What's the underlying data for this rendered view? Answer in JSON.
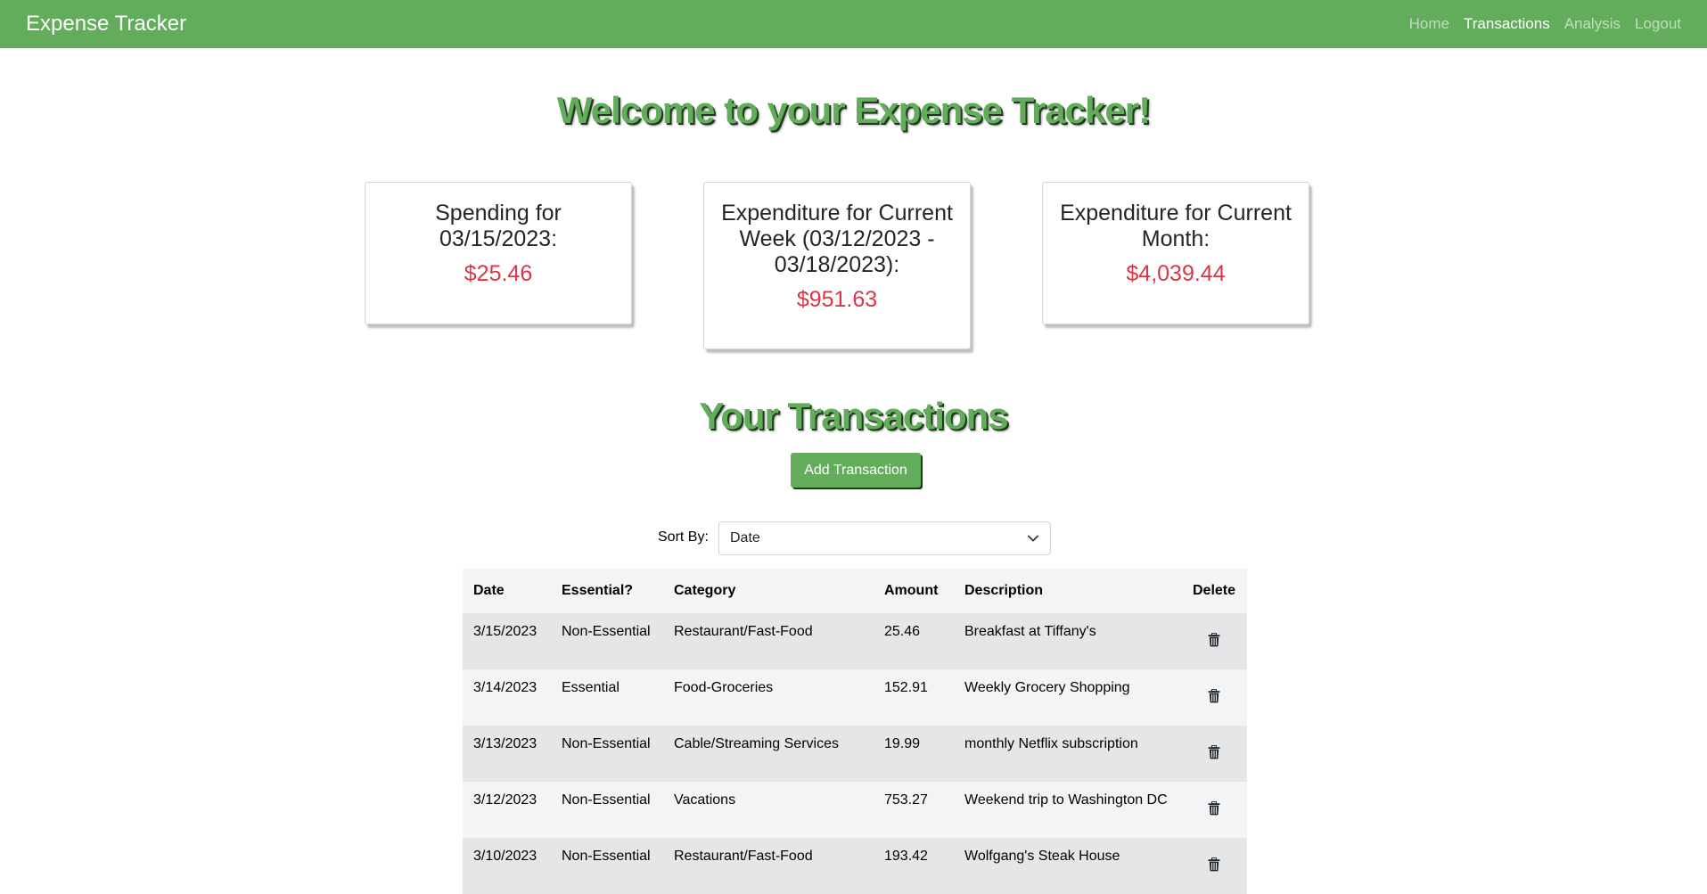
{
  "nav": {
    "brand": "Expense Tracker",
    "links": [
      "Home",
      "Transactions",
      "Analysis",
      "Logout"
    ],
    "active": "Transactions"
  },
  "welcome": "Welcome to your Expense Tracker!",
  "cards": [
    {
      "title": "Spending for 03/15/2023:",
      "value": "$25.46"
    },
    {
      "title": "Expenditure for Current Week (03/12/2023 - 03/18/2023):",
      "value": "$951.63"
    },
    {
      "title": "Expenditure for Current Month:",
      "value": "$4,039.44"
    }
  ],
  "transactions_title": "Your Transactions",
  "add_button": "Add Transaction",
  "sort": {
    "label": "Sort By:",
    "value": "Date"
  },
  "table": {
    "headers": [
      "Date",
      "Essential?",
      "Category",
      "Amount",
      "Description",
      "Delete"
    ],
    "rows": [
      [
        "3/15/2023",
        "Non-Essential",
        "Restaurant/Fast-Food",
        "25.46",
        "Breakfast at Tiffany's"
      ],
      [
        "3/14/2023",
        "Essential",
        "Food-Groceries",
        "152.91",
        "Weekly Grocery Shopping"
      ],
      [
        "3/13/2023",
        "Non-Essential",
        "Cable/Streaming Services",
        "19.99",
        "monthly Netflix subscription"
      ],
      [
        "3/12/2023",
        "Non-Essential",
        "Vacations",
        "753.27",
        "Weekend trip to Washington DC"
      ],
      [
        "3/10/2023",
        "Non-Essential",
        "Restaurant/Fast-Food",
        "193.42",
        "Wolfgang's Steak House"
      ]
    ]
  },
  "colors": {
    "brand_green": "#62ac5b",
    "amount_red": "#dc3545"
  },
  "icons": {
    "delete": "trash-icon",
    "select": "chevron-down-icon"
  }
}
